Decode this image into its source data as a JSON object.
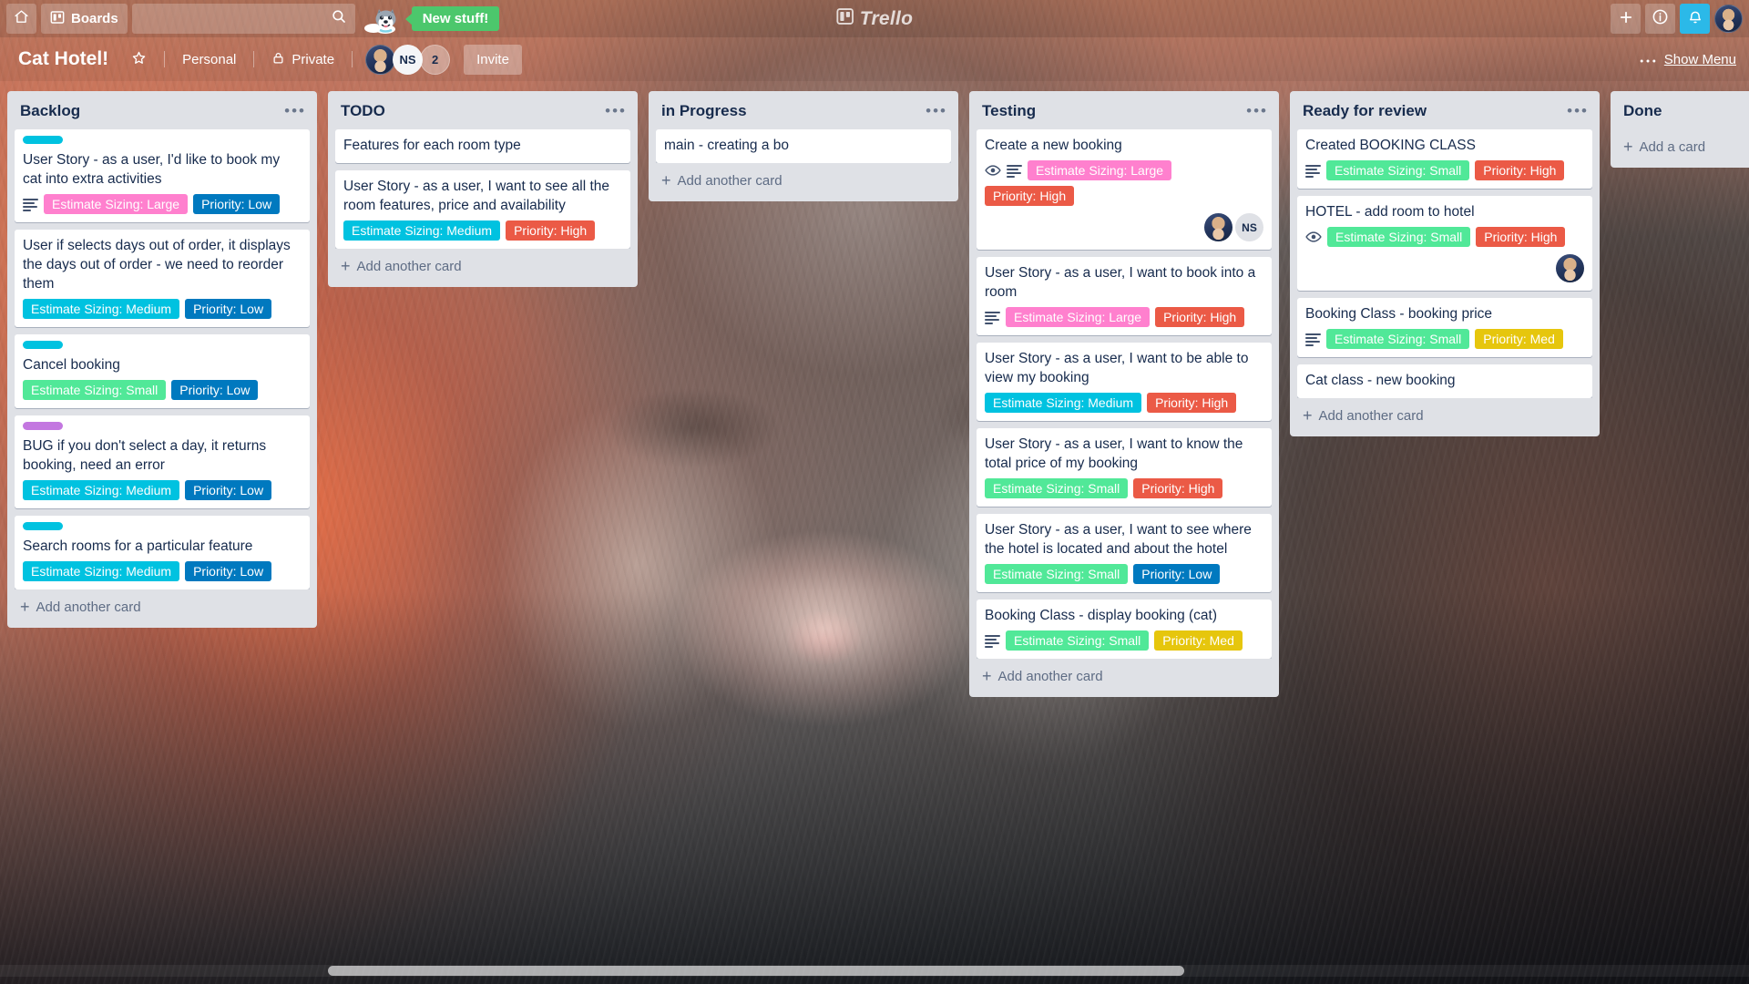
{
  "topbar": {
    "home_icon": "home-icon",
    "boards_label": "Boards",
    "boards_icon": "board-icon",
    "search_placeholder": "",
    "search_value": "",
    "search_icon": "search-icon",
    "mascot_icon": "husky-dog-icon",
    "new_stuff_label": "New stuff!",
    "logo_text": "Trello",
    "logo_icon": "trello-logo-icon",
    "add_icon": "plus-icon",
    "info_icon": "info-icon",
    "bell_icon": "bell-icon",
    "avatar_icon": "user-avatar",
    "accent_green": "#4cc76c",
    "bell_highlight": "#2bb9e8"
  },
  "boardbar": {
    "title": "Cat Hotel!",
    "star_icon": "star-icon",
    "visibility_scope": "Personal",
    "lock_icon": "lock-icon",
    "visibility": "Private",
    "members": [
      {
        "type": "photo",
        "label": ""
      },
      {
        "type": "initials",
        "label": "NS"
      },
      {
        "type": "more",
        "label": "2"
      }
    ],
    "invite_label": "Invite",
    "show_menu_label": "Show Menu",
    "show_menu_icon": "ellipsis-icon"
  },
  "lists": [
    {
      "title": "Backlog",
      "menu_icon": "list-menu-icon",
      "add_card_label": "Add another card",
      "cards": [
        {
          "title": "User Story - as a user, I'd like to book my cat into extra activities",
          "label_bar": "#00c2e0",
          "has_description": true,
          "has_watch": false,
          "labels": [
            {
              "text": "Estimate Sizing: Large",
              "color": "#ff80ce"
            },
            {
              "text": "Priority: Low",
              "color": "#0079bf"
            }
          ],
          "members": []
        },
        {
          "title": "User if selects days out of order, it displays the days out of order - we need to reorder them",
          "label_bar": null,
          "has_description": false,
          "has_watch": false,
          "labels": [
            {
              "text": "Estimate Sizing: Medium",
              "color": "#00c2e0"
            },
            {
              "text": "Priority: Low",
              "color": "#0079bf"
            }
          ],
          "members": []
        },
        {
          "title": "Cancel booking",
          "label_bar": "#00c2e0",
          "has_description": false,
          "has_watch": false,
          "labels": [
            {
              "text": "Estimate Sizing: Small",
              "color": "#51e898"
            },
            {
              "text": "Priority: Low",
              "color": "#0079bf"
            }
          ],
          "members": []
        },
        {
          "title": "BUG if you don't select a day, it returns booking, need an error",
          "label_bar": "#c377e0",
          "has_description": false,
          "has_watch": false,
          "labels": [
            {
              "text": "Estimate Sizing: Medium",
              "color": "#00c2e0"
            },
            {
              "text": "Priority: Low",
              "color": "#0079bf"
            }
          ],
          "members": []
        },
        {
          "title": "Search rooms for a particular feature",
          "label_bar": "#00c2e0",
          "has_description": false,
          "has_watch": false,
          "labels": [
            {
              "text": "Estimate Sizing: Medium",
              "color": "#00c2e0"
            },
            {
              "text": "Priority: Low",
              "color": "#0079bf"
            }
          ],
          "members": []
        }
      ]
    },
    {
      "title": "TODO",
      "menu_icon": "list-menu-icon",
      "add_card_label": "Add another card",
      "cards": [
        {
          "title": "Features for each room type",
          "label_bar": null,
          "has_description": false,
          "has_watch": false,
          "labels": [],
          "members": []
        },
        {
          "title": "User Story - as a user, I want to see all the room features, price and availability",
          "label_bar": null,
          "has_description": false,
          "has_watch": false,
          "labels": [
            {
              "text": "Estimate Sizing: Medium",
              "color": "#00c2e0"
            },
            {
              "text": "Priority: High",
              "color": "#eb5a46"
            }
          ],
          "members": []
        }
      ]
    },
    {
      "title": "in Progress",
      "menu_icon": "list-menu-icon",
      "add_card_label": "Add another card",
      "cards": [
        {
          "title": "main - creating a bo",
          "label_bar": null,
          "has_description": false,
          "has_watch": false,
          "labels": [],
          "members": []
        }
      ]
    },
    {
      "title": "Testing",
      "menu_icon": "list-menu-icon",
      "add_card_label": "Add another card",
      "cards": [
        {
          "title": "Create a new booking",
          "label_bar": null,
          "has_description": true,
          "has_watch": true,
          "labels": [
            {
              "text": "Estimate Sizing: Large",
              "color": "#ff80ce"
            },
            {
              "text": "Priority: High",
              "color": "#eb5a46"
            }
          ],
          "members": [
            {
              "type": "photo",
              "label": ""
            },
            {
              "type": "initials",
              "label": "NS"
            }
          ]
        },
        {
          "title": "User Story - as a user, I want to book into a room",
          "label_bar": null,
          "has_description": true,
          "has_watch": false,
          "labels": [
            {
              "text": "Estimate Sizing: Large",
              "color": "#ff80ce"
            },
            {
              "text": "Priority: High",
              "color": "#eb5a46"
            }
          ],
          "members": []
        },
        {
          "title": "User Story - as a user, I want to be able to view my booking",
          "label_bar": null,
          "has_description": false,
          "has_watch": false,
          "labels": [
            {
              "text": "Estimate Sizing: Medium",
              "color": "#00c2e0"
            },
            {
              "text": "Priority: High",
              "color": "#eb5a46"
            }
          ],
          "members": []
        },
        {
          "title": "User Story - as a user, I want to know the total price of my booking",
          "label_bar": null,
          "has_description": false,
          "has_watch": false,
          "labels": [
            {
              "text": "Estimate Sizing: Small",
              "color": "#51e898"
            },
            {
              "text": "Priority: High",
              "color": "#eb5a46"
            }
          ],
          "members": []
        },
        {
          "title": "User Story - as a user, I want to see where the hotel is located and about the hotel",
          "label_bar": null,
          "has_description": false,
          "has_watch": false,
          "labels": [
            {
              "text": "Estimate Sizing: Small",
              "color": "#51e898"
            },
            {
              "text": "Priority: Low",
              "color": "#0079bf"
            }
          ],
          "members": []
        },
        {
          "title": "Booking Class - display booking (cat)",
          "label_bar": null,
          "has_description": true,
          "has_watch": false,
          "labels": [
            {
              "text": "Estimate Sizing: Small",
              "color": "#51e898"
            },
            {
              "text": "Priority: Med",
              "color": "#e6c60d"
            }
          ],
          "members": []
        }
      ]
    },
    {
      "title": "Ready for review",
      "menu_icon": "list-menu-icon",
      "add_card_label": "Add another card",
      "cards": [
        {
          "title": "Created BOOKING CLASS",
          "label_bar": null,
          "has_description": true,
          "has_watch": false,
          "labels": [
            {
              "text": "Estimate Sizing: Small",
              "color": "#51e898"
            },
            {
              "text": "Priority: High",
              "color": "#eb5a46"
            }
          ],
          "members": []
        },
        {
          "title": "HOTEL - add room to hotel",
          "label_bar": null,
          "has_description": false,
          "has_watch": true,
          "labels": [
            {
              "text": "Estimate Sizing: Small",
              "color": "#51e898"
            },
            {
              "text": "Priority: High",
              "color": "#eb5a46"
            }
          ],
          "members": [
            {
              "type": "photo",
              "label": ""
            }
          ]
        },
        {
          "title": "Booking Class - booking price",
          "label_bar": null,
          "has_description": true,
          "has_watch": false,
          "labels": [
            {
              "text": "Estimate Sizing: Small",
              "color": "#51e898"
            },
            {
              "text": "Priority: Med",
              "color": "#e6c60d"
            }
          ],
          "members": []
        },
        {
          "title": "Cat class - new booking",
          "label_bar": null,
          "has_description": false,
          "has_watch": false,
          "labels": [],
          "members": []
        }
      ]
    },
    {
      "title": "Done",
      "menu_icon": null,
      "add_card_label": "Add a card",
      "cards": []
    }
  ]
}
